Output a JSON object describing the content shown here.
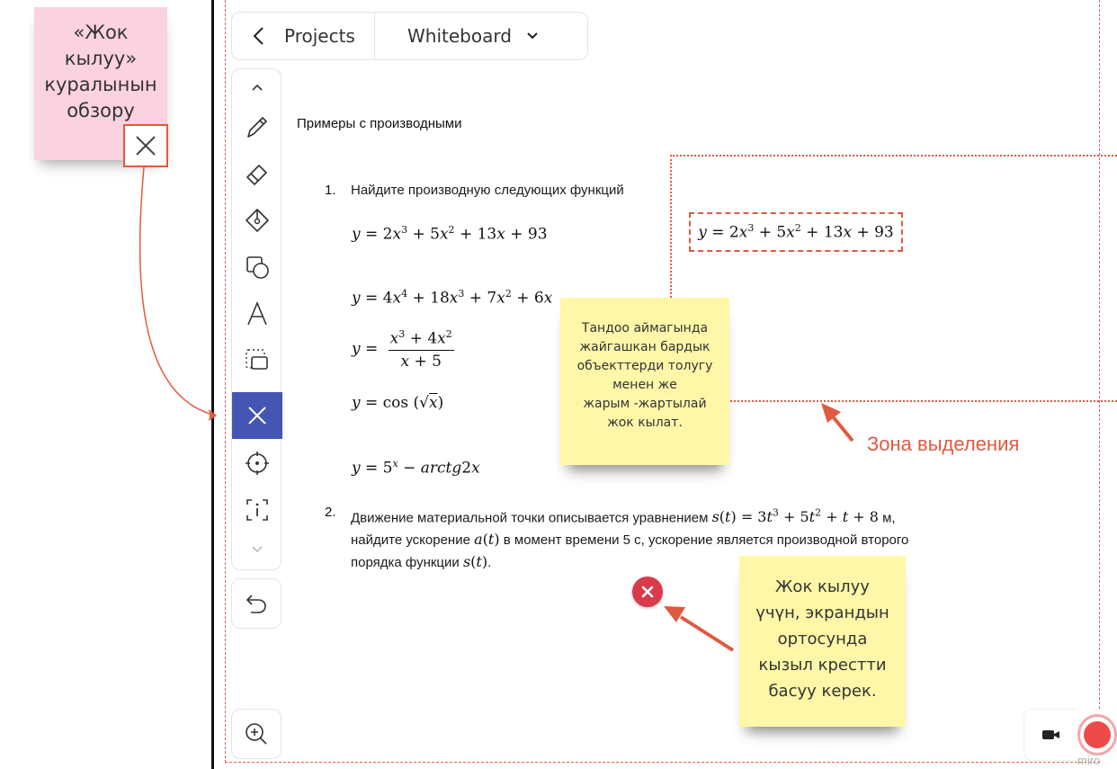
{
  "callouts": {
    "pink_note": [
      "«Жок",
      "кылуу»",
      "куралынын",
      "обзору"
    ],
    "selection_note": [
      "Тандоо аймагында",
      "жайгашкан бардык",
      "объекттерди толугу",
      "менен же",
      "жарым -жартылай",
      "жок кылат."
    ],
    "delete_note": [
      "Жок кылуу",
      "үчүн, экрандын",
      "ортосунда",
      "кызыл крестти",
      "басуу керек."
    ],
    "zone_label": "Зона выделения"
  },
  "topbar": {
    "back_label": "Projects",
    "board_name": "Whiteboard"
  },
  "toolbar": {
    "tools": [
      "scroll-up",
      "pen",
      "eraser",
      "fill",
      "shapes",
      "text",
      "select",
      "delete",
      "laser-pointer",
      "info",
      "scroll-down"
    ],
    "active_tool": "delete"
  },
  "document": {
    "title": "Примеры с производными",
    "q1_number": "1.",
    "q1_text": "Найдите производную следующих функций",
    "q2_number": "2.",
    "q2_text_a": "Движение материальной точки описывается уравнением ",
    "q2_text_b": " м,",
    "q2_text_c": "найдите ускорение ",
    "q2_text_d": " в момент времени 5 с, ускорение является производной второго",
    "q2_text_e": "порядка функции ",
    "q2_text_f": "."
  },
  "colors": {
    "accent_red": "#e05a3f",
    "active_tool_bg": "#4455b4",
    "note_yellow": "#fff7a8",
    "note_pink": "#fbd2e0"
  },
  "watermark": "miro"
}
